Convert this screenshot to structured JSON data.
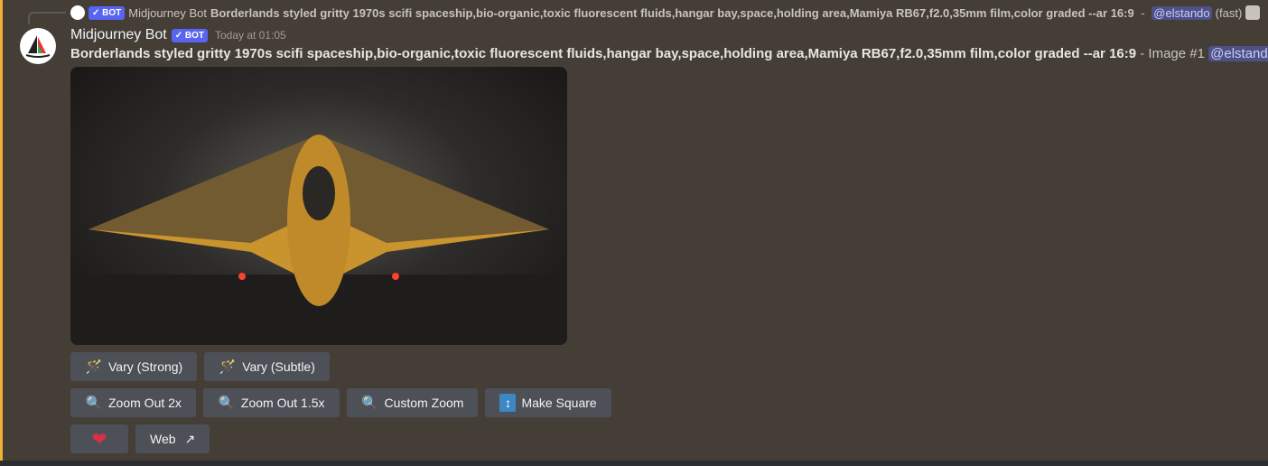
{
  "reply": {
    "bot_badge": "✓ BOT",
    "author": "Midjourney Bot",
    "prompt": "Borderlands styled gritty 1970s scifi spaceship,bio-organic,toxic fluorescent fluids,hangar bay,space,holding area,Mamiya RB67,f2.0,35mm film,color graded --ar 16:9",
    "separator": " - ",
    "mention": "@elstando",
    "speed": "(fast)",
    "attachment_icon": "image-icon"
  },
  "message": {
    "author": "Midjourney Bot",
    "bot_badge": "✓ BOT",
    "timestamp": "Today at 01:05",
    "prompt": "Borderlands styled gritty 1970s scifi spaceship,bio-organic,toxic fluorescent fluids,hangar bay,space,holding area,Mamiya RB67,f2.0,35mm film,color graded --ar 16:9",
    "suffix": " - Image #1 ",
    "mention": "@elstando"
  },
  "buttons": {
    "row1": [
      {
        "icon": "magic-wand-icon",
        "glyph": "🪄",
        "label": "Vary (Strong)"
      },
      {
        "icon": "magic-wand-icon",
        "glyph": "🪄",
        "label": "Vary (Subtle)"
      }
    ],
    "row2": [
      {
        "icon": "magnifier-icon",
        "glyph": "🔍",
        "label": "Zoom Out 2x"
      },
      {
        "icon": "magnifier-icon",
        "glyph": "🔍",
        "label": "Zoom Out 1.5x"
      },
      {
        "icon": "magnifier-icon",
        "glyph": "🔍",
        "label": "Custom Zoom"
      },
      {
        "icon": "up-down-arrow-icon",
        "glyph": "↕",
        "label": "Make Square"
      }
    ],
    "row3": {
      "heart_glyph": "❤",
      "web_label": "Web",
      "external_glyph": "↗"
    }
  },
  "colors": {
    "accent_bar": "#f0b232",
    "bot_badge": "#5865f2",
    "button": "#4e5058",
    "heart": "#dd2e44"
  }
}
